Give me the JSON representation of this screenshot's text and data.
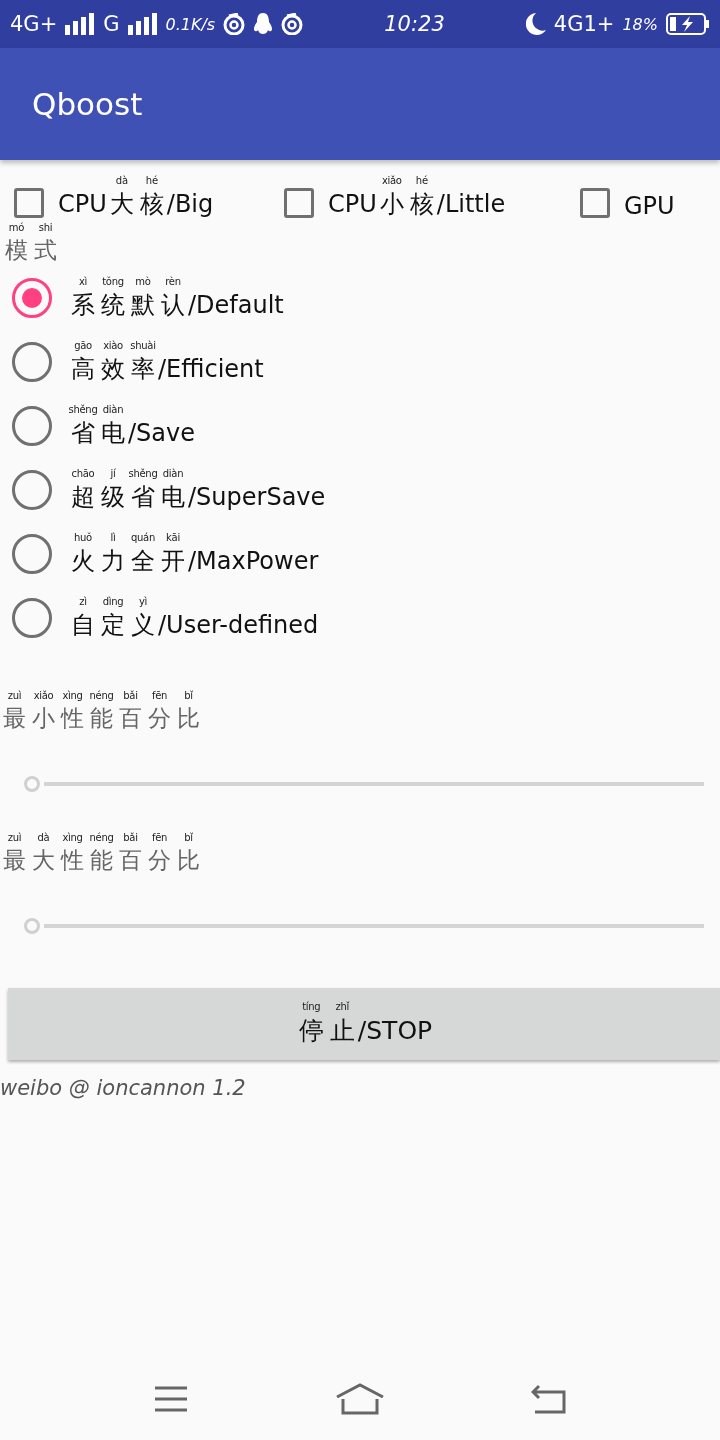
{
  "status_bar": {
    "network_1": "4G+",
    "network_2": "G",
    "speed": "0.1K/s",
    "time": "10:23",
    "network_3": "4G1+",
    "battery": "18%"
  },
  "app_bar": {
    "title": "Qboost"
  },
  "cores": [
    {
      "label": "CPU大核/Big",
      "pinyin": [
        "dà",
        "hé"
      ],
      "checked": false
    },
    {
      "label": "CPU小核/Little",
      "pinyin": [
        "xiǎo",
        "hé"
      ],
      "checked": false
    },
    {
      "label": "GPU",
      "checked": false
    }
  ],
  "mode": {
    "heading": "模式",
    "pinyin": [
      "mó",
      "shi"
    ],
    "options": [
      {
        "label": "系统默认/Default",
        "pinyin": [
          "xì",
          "tǒng",
          "mò",
          "rèn"
        ],
        "selected": true
      },
      {
        "label": "高效率/Efficient",
        "pinyin": [
          "gāo",
          "xiào",
          "shuài"
        ],
        "selected": false
      },
      {
        "label": "省电/Save",
        "pinyin": [
          "shěng",
          "diàn"
        ],
        "selected": false
      },
      {
        "label": "超级省电/SuperSave",
        "pinyin": [
          "chāo",
          "jí",
          "shěng",
          "diàn"
        ],
        "selected": false
      },
      {
        "label": "火力全开/MaxPower",
        "pinyin": [
          "huǒ",
          "lì",
          "quán",
          "kāi"
        ],
        "selected": false
      },
      {
        "label": "自定义/User-defined",
        "pinyin": [
          "zì",
          "dìng",
          "yì"
        ],
        "selected": false
      }
    ]
  },
  "sliders": [
    {
      "label": "最小性能百分比",
      "pinyin": [
        "zuì",
        "xiǎo",
        "xìng",
        "néng",
        "bǎi",
        "fēn",
        "bǐ"
      ],
      "level": 0
    },
    {
      "label": "最大性能百分比",
      "pinyin": [
        "zuì",
        "dà",
        "xìng",
        "néng",
        "bǎi",
        "fēn",
        "bǐ"
      ],
      "level": 0
    }
  ],
  "stop_button": {
    "label": "停止/STOP",
    "pinyin": [
      "tíng",
      "zhǐ"
    ]
  },
  "footer": "weibo @ ioncannon 1.2"
}
